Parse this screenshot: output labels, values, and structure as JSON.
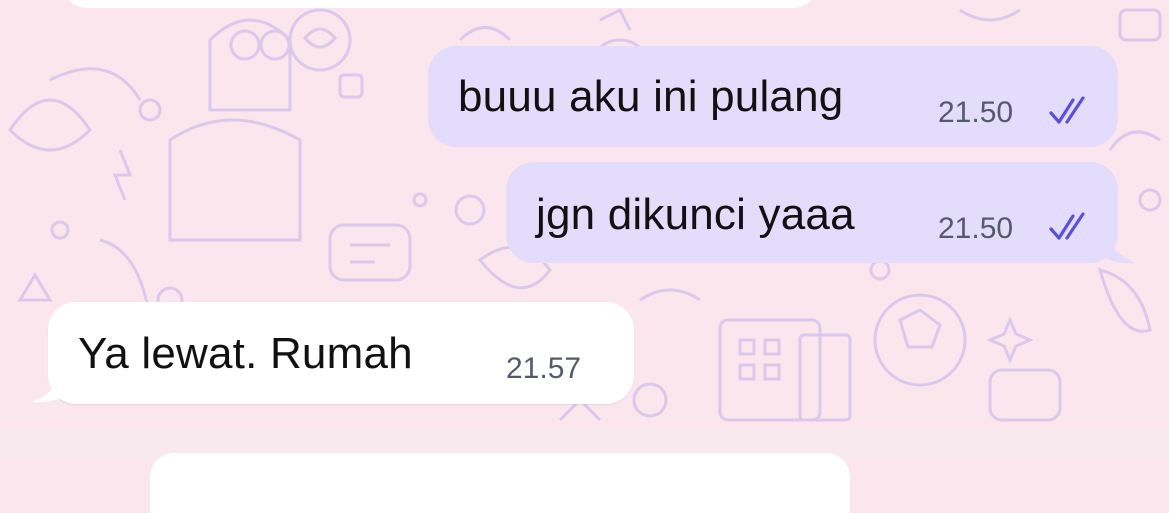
{
  "messages": [
    {
      "direction": "outgoing",
      "text": "buuu aku ini pulang",
      "time": "21.50",
      "status": "read"
    },
    {
      "direction": "outgoing",
      "text": "jgn dikunci yaaa",
      "time": "21.50",
      "status": "read"
    },
    {
      "direction": "incoming",
      "text": "Ya lewat.  Rumah",
      "time": "21.57"
    }
  ],
  "colors": {
    "background": "#fbe6ee",
    "outgoing_bubble": "#e3dcfb",
    "incoming_bubble": "#ffffff",
    "read_ticks": "#5b50d6",
    "timestamp": "#555a6b"
  }
}
